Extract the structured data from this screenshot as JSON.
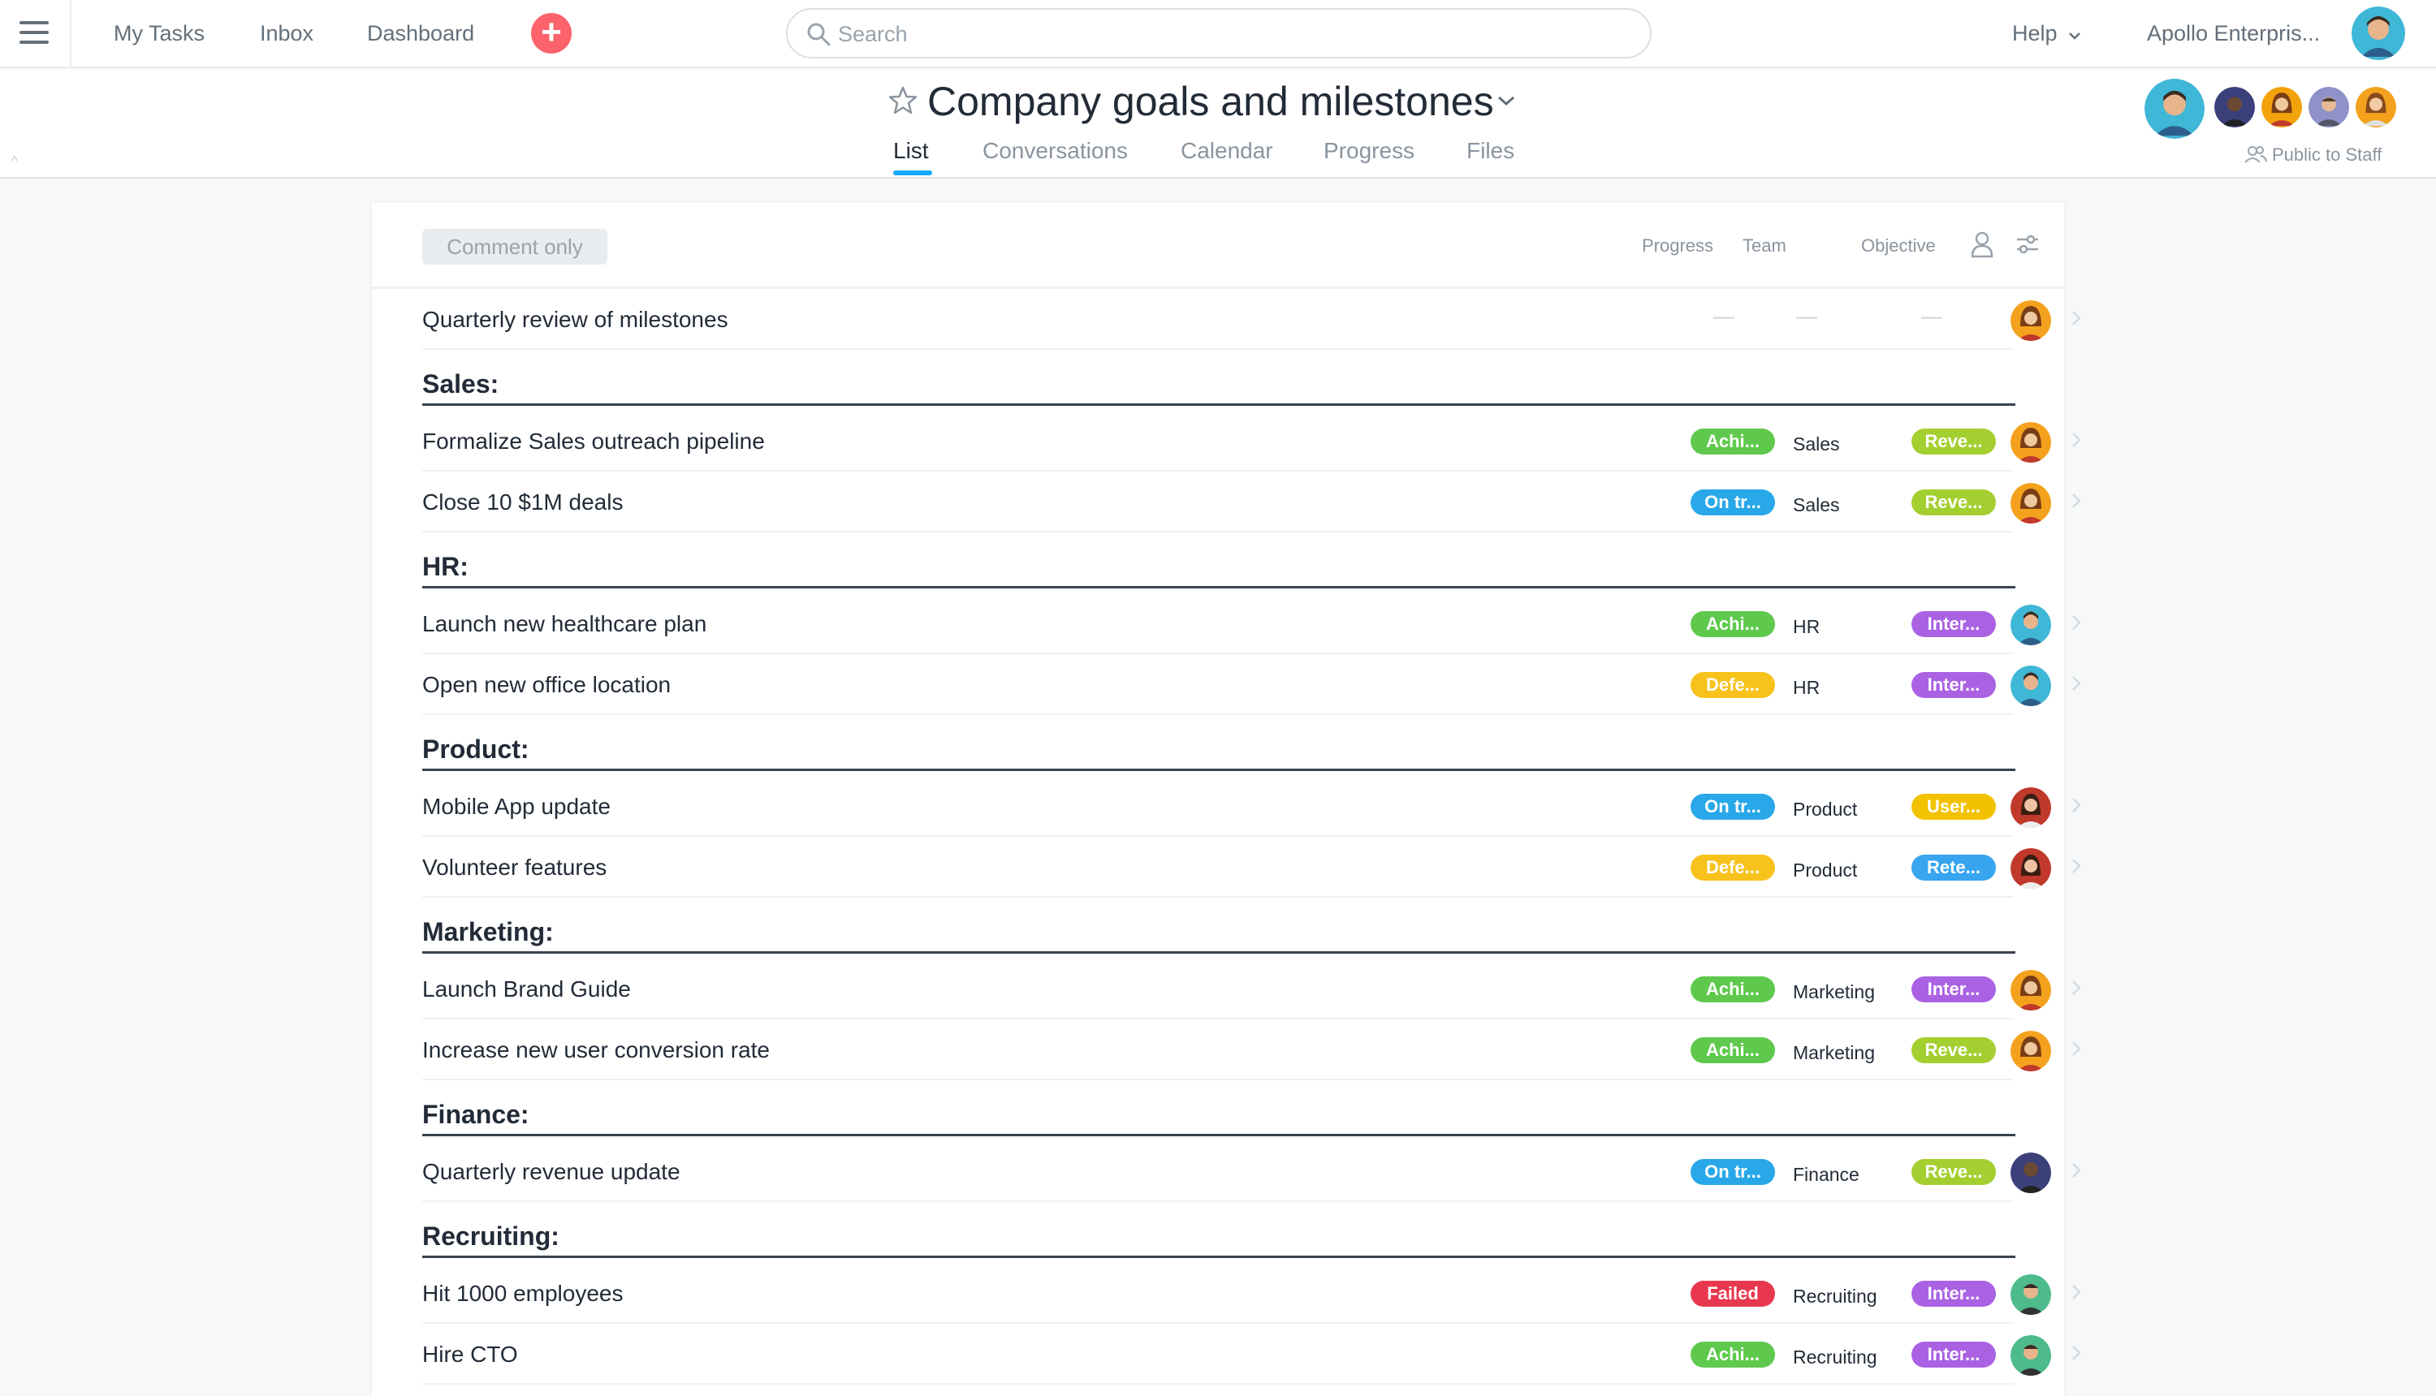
{
  "topbar": {
    "nav": [
      "My Tasks",
      "Inbox",
      "Dashboard"
    ],
    "search_placeholder": "Search",
    "help": "Help",
    "org": "Apollo Enterpris...",
    "add_color": "#fc636b"
  },
  "project": {
    "title": "Company goals and milestones",
    "tabs": [
      "List",
      "Conversations",
      "Calendar",
      "Progress",
      "Files"
    ],
    "active_tab": "List",
    "visibility": "Public to Staff"
  },
  "list": {
    "permission": "Comment only",
    "columns": {
      "progress": "Progress",
      "team": "Team",
      "objective": "Objective"
    },
    "first_task": {
      "name": "Quarterly review of milestones",
      "empty": "—"
    },
    "sections": [
      {
        "title": "Sales:",
        "tasks": [
          {
            "name": "Formalize Sales outreach pipeline",
            "progress": "Achi...",
            "team": "Sales",
            "objective": "Reve..."
          },
          {
            "name": "Close 10 $1M deals",
            "progress": "On tr...",
            "team": "Sales",
            "objective": "Reve..."
          }
        ]
      },
      {
        "title": "HR:",
        "tasks": [
          {
            "name": "Launch new healthcare plan",
            "progress": "Achi...",
            "team": "HR",
            "objective": "Inter..."
          },
          {
            "name": "Open new office location",
            "progress": "Defe...",
            "team": "HR",
            "objective": "Inter..."
          }
        ]
      },
      {
        "title": "Product:",
        "tasks": [
          {
            "name": "Mobile App update",
            "progress": "On tr...",
            "team": "Product",
            "objective": "User..."
          },
          {
            "name": "Volunteer features",
            "progress": "Defe...",
            "team": "Product",
            "objective": "Rete..."
          }
        ]
      },
      {
        "title": "Marketing:",
        "tasks": [
          {
            "name": "Launch Brand Guide",
            "progress": "Achi...",
            "team": "Marketing",
            "objective": "Inter..."
          },
          {
            "name": "Increase new user conversion rate",
            "progress": "Achi...",
            "team": "Marketing",
            "objective": "Reve..."
          }
        ]
      },
      {
        "title": "Finance:",
        "tasks": [
          {
            "name": "Quarterly revenue update",
            "progress": "On tr...",
            "team": "Finance",
            "objective": "Reve..."
          }
        ]
      },
      {
        "title": "Recruiting:",
        "tasks": [
          {
            "name": "Hit 1000 employees",
            "progress": "Failed",
            "team": "Recruiting",
            "objective": "Inter..."
          },
          {
            "name": "Hire CTO",
            "progress": "Achi...",
            "team": "Recruiting",
            "objective": "Inter..."
          }
        ]
      }
    ]
  },
  "pill_colors": {
    "Achi...": "#5fc94d",
    "On tr...": "#29a8e9",
    "Defe...": "#f8c21d",
    "Failed": "#e8384f",
    "Reve...": "#a4cf30",
    "Inter...": "#aa62e3",
    "User...": "#f2c200",
    "Rete...": "#37a5ef"
  }
}
